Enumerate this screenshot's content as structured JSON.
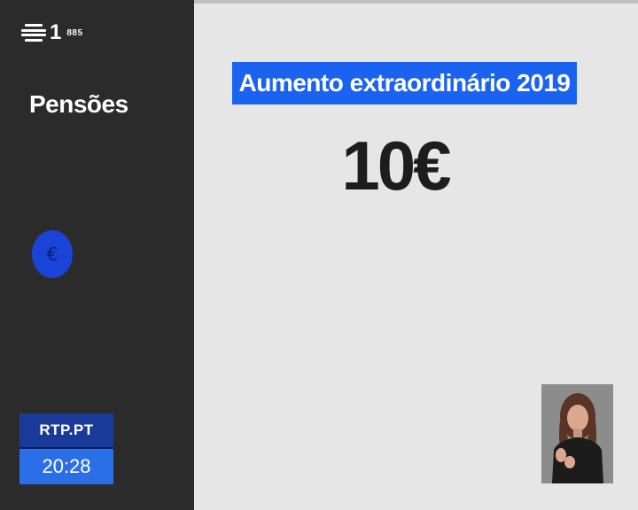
{
  "channel": {
    "number": "1",
    "code": "885",
    "logo_icon": "rtp-logo-icon"
  },
  "sidebar": {
    "section_title": "Pensões",
    "currency_icon": "€"
  },
  "footer": {
    "site": "RTP.PT",
    "time": "20:28"
  },
  "main": {
    "headline": "Aumento extraordinário 2019",
    "amount": "10€"
  },
  "colors": {
    "headline_bar": "#1a63f0",
    "site_label": "#1a3a9a",
    "clock": "#2a6fe8",
    "sidebar": "#2b2b2b",
    "background": "#e6e6e6"
  }
}
